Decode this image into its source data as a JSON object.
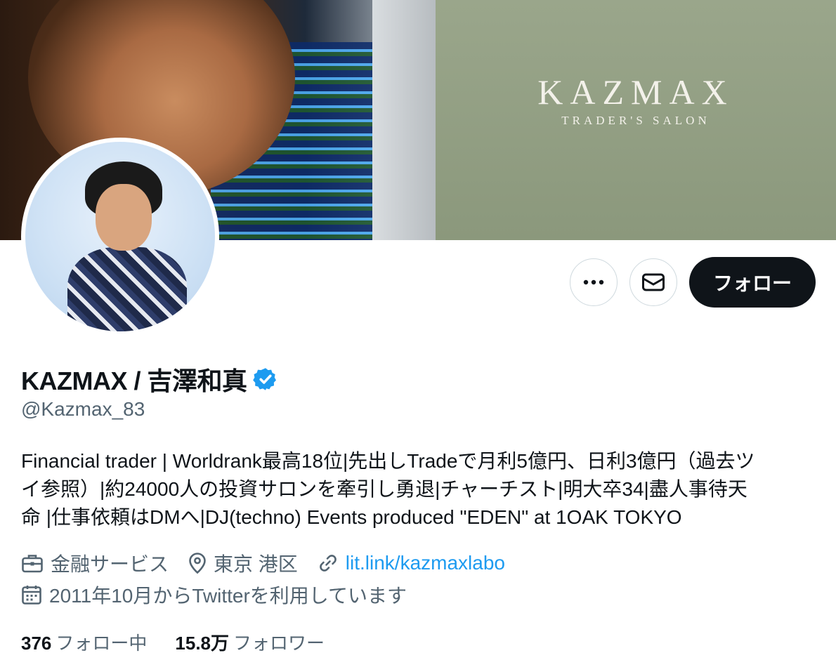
{
  "banner": {
    "brand": "KAZMAX",
    "tagline": "TRADER'S SALON"
  },
  "actions": {
    "more_icon": "more-horizontal-icon",
    "message_icon": "envelope-icon",
    "follow_label": "フォロー"
  },
  "profile": {
    "display_name": "KAZMAX / 吉澤和真",
    "verified": true,
    "verified_color": "#1d9bf0",
    "handle": "@Kazmax_83",
    "bio_lines": [
      "Financial trader | Worldrank最高18位|先出しTradeで月利5億円、日利3億円（過去ツ",
      "イ参照）|約24000人の投資サロンを牽引し勇退|チャーチスト|明大卒34|盡人事待天",
      "命 |仕事依頼はDMへ|DJ(techno) Events produced \"EDEN\" at 1OAK TOKYO"
    ],
    "category": "金融サービス",
    "location": "東京 港区",
    "link": "lit.link/kazmaxlabo",
    "joined": "2011年10月からTwitterを利用しています"
  },
  "stats": {
    "following_count": "376",
    "following_label": "フォロー中",
    "followers_count": "15.8万",
    "followers_label": "フォロワー"
  },
  "colors": {
    "text_primary": "#0f1419",
    "text_secondary": "#536471",
    "link": "#1d9bf0",
    "follow_button": "#0f1419"
  }
}
